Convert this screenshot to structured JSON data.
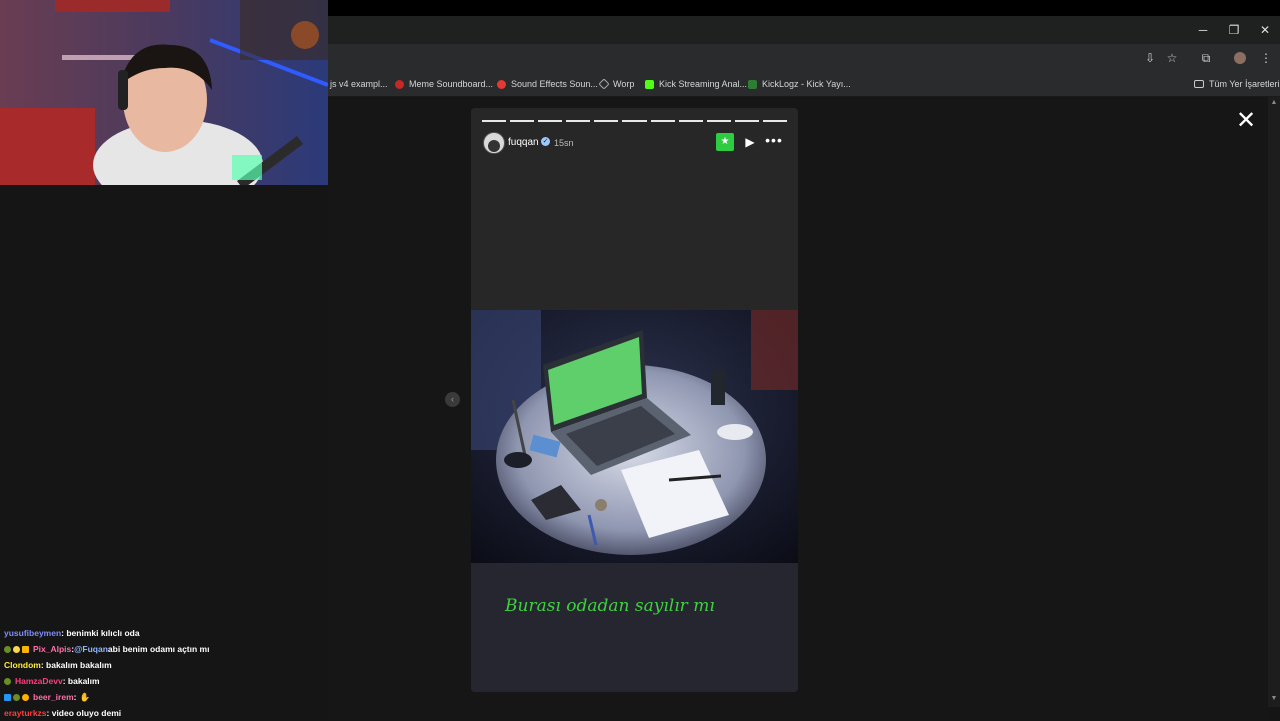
{
  "window": {
    "minimize": "─",
    "restore": "❐",
    "close": "✕"
  },
  "toolbar": {
    "install_icon": "⇩",
    "star_icon": "☆",
    "extensions_icon": "⧉",
    "menu_icon": "⋮"
  },
  "bookmarks": {
    "items": [
      {
        "label": "js v4 exampl...",
        "color": "#2a2b2c"
      },
      {
        "label": "Meme Soundboard...",
        "color": "#c62828"
      },
      {
        "label": "Sound Effects Soun...",
        "color": "#e53935"
      },
      {
        "label": "Worp",
        "color": "#9e9e9e"
      },
      {
        "label": "Kick Streaming Anal...",
        "color": "#53fc18"
      },
      {
        "label": "KickLogz - Kick Yayı...",
        "color": "#2e7d32"
      }
    ],
    "all_bookmarks": "Tüm Yer İşaretleri"
  },
  "story": {
    "username": "fuqqan",
    "time_ago": "15sn",
    "caption": "Burası odadan sayılır mı",
    "segments": 11
  },
  "chat": [
    {
      "user": "yusufibeymen",
      "user_color": "#7f8cff",
      "message": ": benimki kılıclı oda",
      "badges": []
    },
    {
      "user": "Pix_Alpis",
      "user_color": "#ff6fa8",
      "message": ": ",
      "mention": "@Fuqan",
      "mention_color": "#8fb8ff",
      "message2": " abi benim odamı açtın mı",
      "badges": [
        "#6b8e23",
        "#ffd54f",
        "#ffb300"
      ]
    },
    {
      "user": "Clondom",
      "user_color": "#ffeb3b",
      "message": ": bakalım bakalım",
      "badges": []
    },
    {
      "user": "HamzaDevv",
      "user_color": "#ff3d7f",
      "message": ": bakalım",
      "badges": [
        "#6b8e23"
      ]
    },
    {
      "user": "beer_irem",
      "user_color": "#ff6fa8",
      "message": ": ",
      "emote": "✋",
      "badges": [
        "#2196f3",
        "#6b8e23",
        "#ffb300"
      ]
    },
    {
      "user": "erayturkzs",
      "user_color": "#ff3d3d",
      "message": ": video oluyo demi",
      "badges": []
    }
  ],
  "colors": {
    "kick_green": "#2ecc40",
    "caption_green": "#3dd23d"
  }
}
